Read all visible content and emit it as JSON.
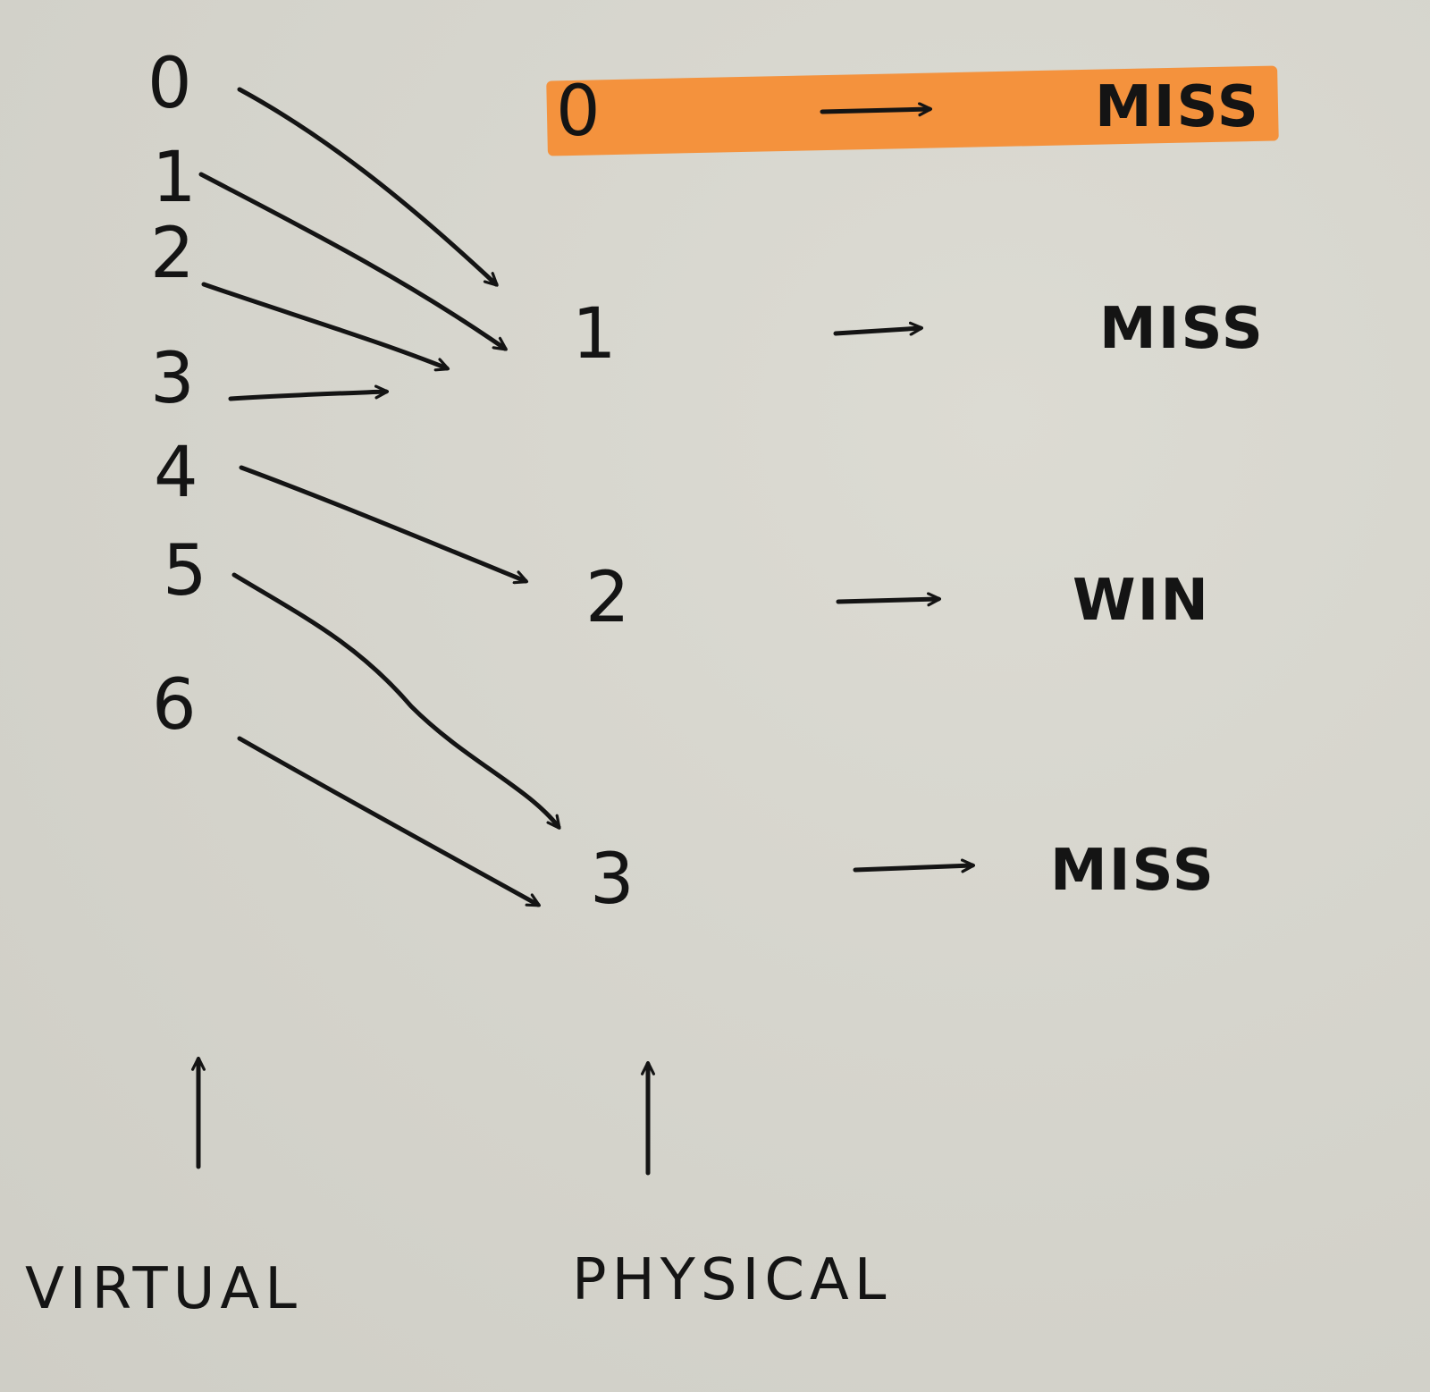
{
  "virtual_pages": [
    "0",
    "1",
    "2",
    "3",
    "4",
    "5",
    "6"
  ],
  "physical_pages": [
    "0",
    "1",
    "2",
    "3"
  ],
  "results": [
    "MISS",
    "MISS",
    "WIN",
    "MISS"
  ],
  "mappings": [
    {
      "from": "0",
      "to": "1"
    },
    {
      "from": "1",
      "to": "1"
    },
    {
      "from": "2",
      "to": "1"
    },
    {
      "from": "3",
      "to": "1"
    },
    {
      "from": "4",
      "to": "2"
    },
    {
      "from": "5",
      "to": "3"
    },
    {
      "from": "6",
      "to": "3"
    }
  ],
  "highlighted_row": "0",
  "labels": {
    "virtual": "VIRTUAL",
    "physical": "PHYSICAL"
  },
  "colors": {
    "ink": "#141414",
    "highlight": "#f58e35",
    "paper": "#d6d5cd"
  }
}
